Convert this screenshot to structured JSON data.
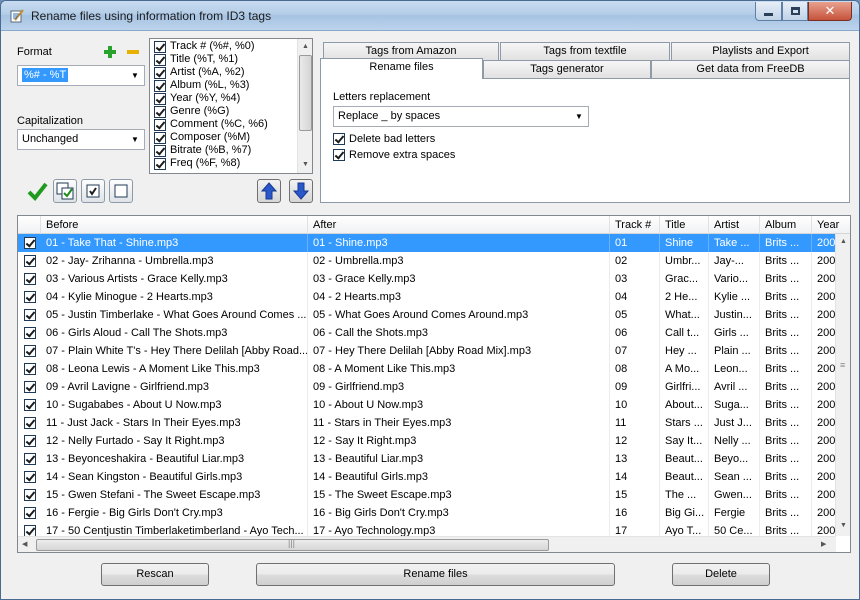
{
  "window": {
    "title": "Rename files using information from ID3 tags"
  },
  "format": {
    "label": "Format",
    "value": "%# - %T",
    "capitalization_label": "Capitalization",
    "capitalization_value": "Unchanged"
  },
  "tags": [
    {
      "label": "Track # (%#, %0)",
      "checked": true
    },
    {
      "label": "Title (%T, %1)",
      "checked": true
    },
    {
      "label": "Artist (%A, %2)",
      "checked": true
    },
    {
      "label": "Album (%L, %3)",
      "checked": true
    },
    {
      "label": "Year (%Y, %4)",
      "checked": true
    },
    {
      "label": "Genre (%G)",
      "checked": true
    },
    {
      "label": "Comment (%C, %6)",
      "checked": true
    },
    {
      "label": "Composer (%M)",
      "checked": true
    },
    {
      "label": "Bitrate (%B, %7)",
      "checked": true
    },
    {
      "label": "Freq (%F, %8)",
      "checked": true
    }
  ],
  "tabs": {
    "top_row": [
      "Tags from Amazon",
      "Tags from textfile",
      "Playlists and Export"
    ],
    "bottom_row": [
      "Rename files",
      "Tags generator",
      "Get data from FreeDB"
    ],
    "active": "Rename files"
  },
  "rename_panel": {
    "letters_label": "Letters replacement",
    "letters_value": "Replace _ by spaces",
    "delete_bad": "Delete bad letters",
    "remove_spaces": "Remove extra spaces"
  },
  "grid": {
    "columns": [
      "Before",
      "After",
      "Track #",
      "Title",
      "Artist",
      "Album",
      "Year"
    ],
    "rows": [
      [
        "01 - Take That - Shine.mp3",
        "01 - Shine.mp3",
        "01",
        "Shine",
        "Take ...",
        "Brits ...",
        "200"
      ],
      [
        "02 - Jay- Zrihanna - Umbrella.mp3",
        "02 - Umbrella.mp3",
        "02",
        "Umbr...",
        "Jay-...",
        "Brits ...",
        "200"
      ],
      [
        "03 - Various Artists - Grace Kelly.mp3",
        "03 - Grace Kelly.mp3",
        "03",
        "Grac...",
        "Vario...",
        "Brits ...",
        "200"
      ],
      [
        "04 - Kylie Minogue - 2 Hearts.mp3",
        "04 - 2 Hearts.mp3",
        "04",
        "2 He...",
        "Kylie ...",
        "Brits ...",
        "200"
      ],
      [
        "05 - Justin Timberlake - What Goes Around Comes ...",
        "05 - What Goes Around Comes Around.mp3",
        "05",
        "What...",
        "Justin...",
        "Brits ...",
        "200"
      ],
      [
        "06 - Girls Aloud - Call The Shots.mp3",
        "06 - Call the Shots.mp3",
        "06",
        "Call t...",
        "Girls ...",
        "Brits ...",
        "200"
      ],
      [
        "07 - Plain White T's - Hey There Delilah [Abby Road...",
        "07 - Hey There Delilah [Abby Road Mix].mp3",
        "07",
        "Hey ...",
        "Plain ...",
        "Brits ...",
        "200"
      ],
      [
        "08 - Leona Lewis - A Moment Like This.mp3",
        "08 - A Moment Like This.mp3",
        "08",
        "A Mo...",
        "Leon...",
        "Brits ...",
        "200"
      ],
      [
        "09 - Avril Lavigne - Girlfriend.mp3",
        "09 - Girlfriend.mp3",
        "09",
        "Girlfri...",
        "Avril ...",
        "Brits ...",
        "200"
      ],
      [
        "10 - Sugababes - About U Now.mp3",
        "10 - About U Now.mp3",
        "10",
        "About...",
        "Suga...",
        "Brits ...",
        "200"
      ],
      [
        "11 - Just Jack - Stars In Their Eyes.mp3",
        "11 - Stars in Their Eyes.mp3",
        "11",
        "Stars ...",
        "Just J...",
        "Brits ...",
        "200"
      ],
      [
        "12 - Nelly Furtado - Say It Right.mp3",
        "12 - Say It Right.mp3",
        "12",
        "Say It...",
        "Nelly ...",
        "Brits ...",
        "200"
      ],
      [
        "13 - Beyonceshakira - Beautiful Liar.mp3",
        "13 - Beautiful Liar.mp3",
        "13",
        "Beaut...",
        "Beyo...",
        "Brits ...",
        "200"
      ],
      [
        "14 - Sean Kingston - Beautiful Girls.mp3",
        "14 - Beautiful Girls.mp3",
        "14",
        "Beaut...",
        "Sean ...",
        "Brits ...",
        "200"
      ],
      [
        "15 - Gwen Stefani - The Sweet Escape.mp3",
        "15 - The Sweet Escape.mp3",
        "15",
        "The ...",
        "Gwen...",
        "Brits ...",
        "200"
      ],
      [
        "16 - Fergie - Big Girls Don't Cry.mp3",
        "16 - Big Girls Don't Cry.mp3",
        "16",
        "Big Gi...",
        "Fergie",
        "Brits ...",
        "200"
      ],
      [
        "17 - 50 Centjustin Timberlaketimberland - Ayo Tech...",
        "17 - Ayo Technology.mp3",
        "17",
        "Ayo T...",
        "50 Ce...",
        "Brits ...",
        "200"
      ]
    ]
  },
  "buttons": {
    "rescan": "Rescan",
    "rename": "Rename files",
    "delete": "Delete"
  }
}
